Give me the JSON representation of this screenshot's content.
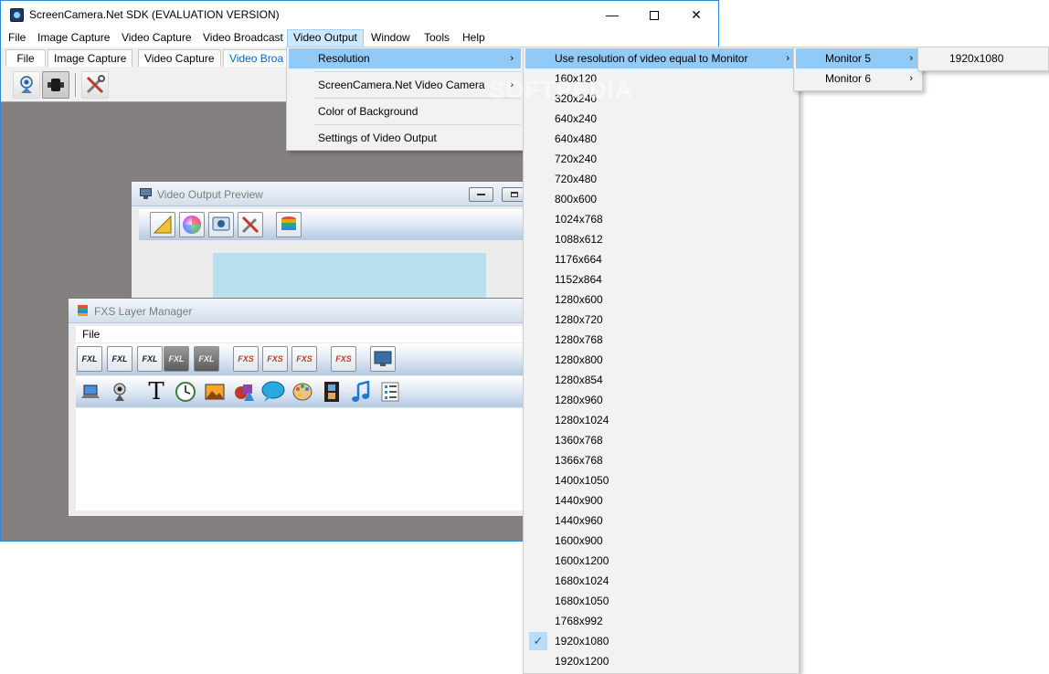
{
  "window": {
    "title": "ScreenCamera.Net SDK (EVALUATION VERSION)",
    "minimize": "—",
    "close": "✕"
  },
  "menubar": [
    "File",
    "Image Capture",
    "Video Capture",
    "Video Broadcast",
    "Video Output",
    "Window",
    "Tools",
    "Help"
  ],
  "tabs": [
    "File",
    "Image Capture",
    "Video Capture",
    "Video Broa"
  ],
  "video_output_menu": {
    "items": [
      "Resolution",
      "ScreenCamera.Net Video Camera",
      "Color of Background",
      "Settings of Video Output"
    ]
  },
  "resolution_menu": {
    "use_monitor": "Use resolution of video equal to Monitor",
    "items": [
      "160x120",
      "320x240",
      "640x240",
      "640x480",
      "720x240",
      "720x480",
      "800x600",
      "1024x768",
      "1088x612",
      "1176x664",
      "1152x864",
      "1280x600",
      "1280x720",
      "1280x768",
      "1280x800",
      "1280x854",
      "1280x960",
      "1280x1024",
      "1360x768",
      "1366x768",
      "1400x1050",
      "1440x900",
      "1440x960",
      "1600x900",
      "1600x1200",
      "1680x1024",
      "1680x1050",
      "1768x992",
      "1920x1080",
      "1920x1200"
    ],
    "checked": "1920x1080",
    "check_glyph": "✓"
  },
  "monitor_menu": {
    "items": [
      "Monitor 5",
      "Monitor 6"
    ]
  },
  "monitor5_menu": {
    "items": [
      "1920x1080"
    ]
  },
  "submenu_arrow": "›",
  "preview_window": {
    "title": "Video Output Preview"
  },
  "fxs_window": {
    "title": "FXS Layer Manager",
    "menu_file": "File",
    "text_tool": "T",
    "fxl_label": "FXL",
    "fxs_label": "FXS"
  },
  "watermark": "SOFTPEDIA",
  "colors": {
    "accent": "#2c88d9",
    "menu_highlight": "#91c9f7",
    "mdi_background": "#848080",
    "preview_canvas": "#b8e0ee"
  }
}
